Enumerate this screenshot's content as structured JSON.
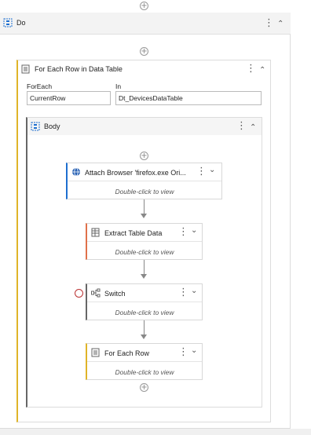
{
  "do_block": {
    "title": "Do"
  },
  "for_each_row": {
    "title": "For Each Row in Data Table",
    "foreach_label": "ForEach",
    "foreach_value": "CurrentRow",
    "in_label": "In",
    "in_value": "Dt_DevicesDataTable"
  },
  "body_block": {
    "title": "Body"
  },
  "activities": [
    {
      "title": "Attach Browser 'firefox.exe Ori...",
      "subtitle": "Double-click to view",
      "accent": "#1e6fd0"
    },
    {
      "title": "Extract Table Data",
      "subtitle": "Double-click to view",
      "accent": "#e0704a"
    },
    {
      "title": "Switch",
      "subtitle": "Double-click to view",
      "accent": "#666666"
    },
    {
      "title": "For Each Row",
      "subtitle": "Double-click to view",
      "accent": "#e0b428"
    }
  ],
  "icons": {
    "kebab": "⋮",
    "collapse": "⌃",
    "expand": "⌄",
    "plus": "+"
  },
  "colors": {
    "sequence_accent": "#e0b428",
    "body_accent": "#666666"
  }
}
